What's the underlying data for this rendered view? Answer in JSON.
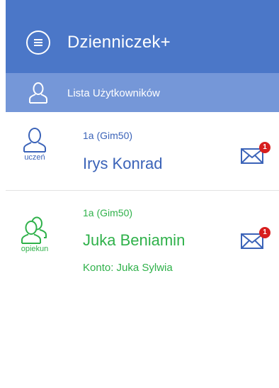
{
  "header": {
    "title": "Dzienniczek+",
    "menu_icon": "menu-icon"
  },
  "subheader": {
    "label": "Lista Użytkowników",
    "icon": "user-icon"
  },
  "users": [
    {
      "role": "uczeń",
      "class": "1a (Gim50)",
      "name": "Irys Konrad",
      "account": "",
      "unread_messages": "1",
      "role_color": "#3b63b8"
    },
    {
      "role": "opiekun",
      "class": "1a (Gim50)",
      "name": "Juka Beniamin",
      "account": "Konto: Juka Sylwia",
      "unread_messages": "1",
      "role_color": "#2fb14a"
    }
  ],
  "colors": {
    "header_bg": "#4b77c8",
    "subheader_bg": "#7597d8",
    "badge": "#d71e1e"
  }
}
